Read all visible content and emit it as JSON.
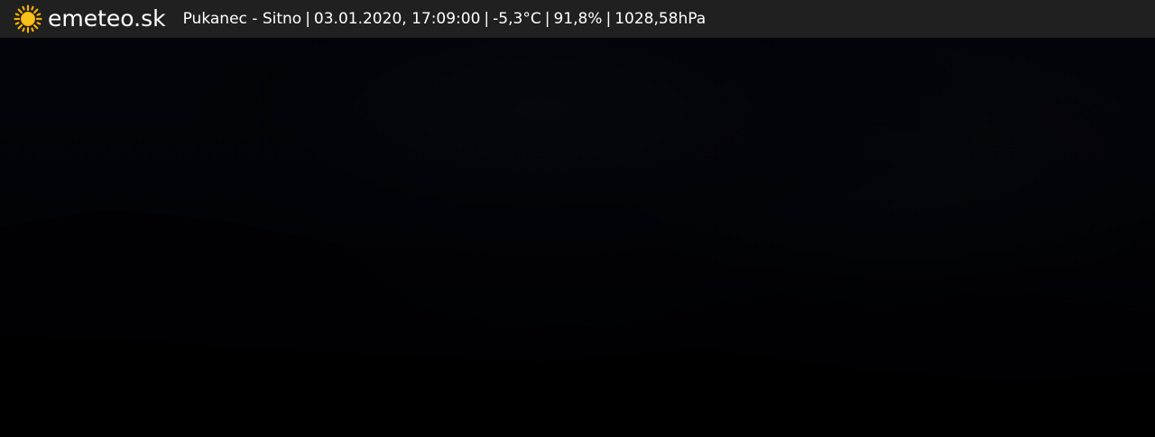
{
  "brand": {
    "name": "emeteo.sk",
    "icon": "sun-icon",
    "icon_color": "#f7b500"
  },
  "caption": {
    "location": "Pukanec - Sitno",
    "datetime": "03.01.2020, 17:09:00",
    "temperature": "-5,3°C",
    "humidity": "91,8%",
    "pressure": "1028,58hPa",
    "separator": "|"
  },
  "colors": {
    "topbar": "#202020",
    "background": "#000000",
    "text": "#ffffff"
  }
}
